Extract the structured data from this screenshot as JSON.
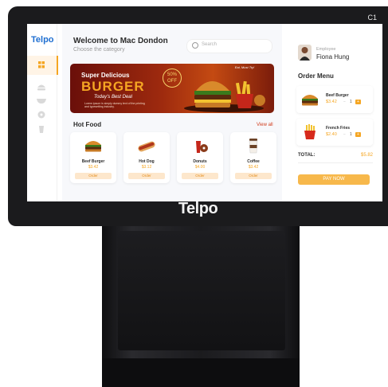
{
  "device": {
    "model_tag": "C1",
    "chin_logo": "Telpo"
  },
  "app": {
    "brand": "Telpo",
    "header": {
      "title": "Welcome to Mac Dondon",
      "subtitle": "Choose the category",
      "search_placeholder": "Search"
    },
    "sidebar": {
      "items": [
        {
          "icon": "grid-icon",
          "active": true
        },
        {
          "icon": "burger-icon",
          "active": false
        },
        {
          "icon": "bowl-icon",
          "active": false
        },
        {
          "icon": "donut-icon",
          "active": false
        },
        {
          "icon": "drink-icon",
          "active": false
        }
      ]
    },
    "banner": {
      "super": "Super Delicious",
      "headline": "BURGER",
      "today": "Today's Best Deal",
      "fine_print": "Lorem ipsum is simply dummy text of the printing and typesetting industry.",
      "badge": "50% OFF",
      "tag": "Eat, Must Try!"
    },
    "hot_food": {
      "title": "Hot Food",
      "view_all": "View all",
      "items": [
        {
          "name": "Beef Burger",
          "price": "$3.42",
          "button": "Order",
          "icon": "burger-icon"
        },
        {
          "name": "Hot Dog",
          "price": "$3.12",
          "button": "Order",
          "icon": "hotdog-icon"
        },
        {
          "name": "Donuts",
          "price": "$4.00",
          "button": "Order",
          "icon": "donut-icon"
        },
        {
          "name": "Coffee",
          "price": "$3.42",
          "button": "Order",
          "icon": "coffee-icon"
        }
      ]
    },
    "order_panel": {
      "employee_label": "Employee",
      "employee_name": "Fiona Hung",
      "title": "Order Menu",
      "items": [
        {
          "name": "Beef Burger",
          "price": "$3.42",
          "qty": "1",
          "icon": "burger-icon"
        },
        {
          "name": "French Fries",
          "price": "$2.40",
          "qty": "1",
          "icon": "fries-icon"
        }
      ],
      "total_label": "TOTAL:",
      "total_value": "$5.82",
      "pay_button": "PAY NOW"
    }
  },
  "colors": {
    "accent": "#f5a623",
    "brand_blue": "#1f6fd1",
    "bezel": "#1b1b1d"
  }
}
